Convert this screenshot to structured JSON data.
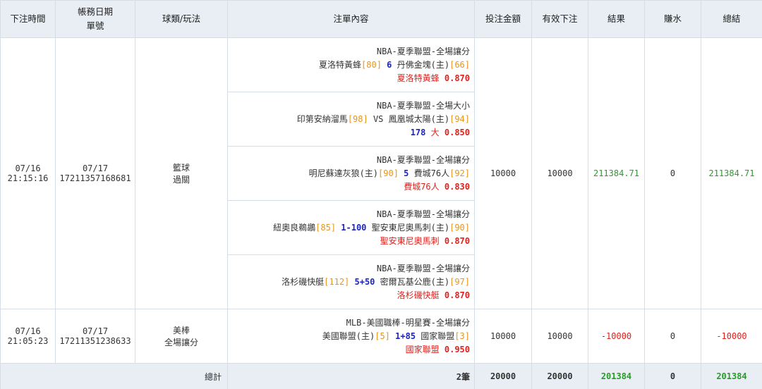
{
  "headers": {
    "time": "下注時間",
    "date_line1": "帳務日期",
    "date_line2": "單號",
    "type": "球類/玩法",
    "content": "注單內容",
    "amount": "投注金額",
    "valid": "有效下注",
    "result": "結果",
    "water": "賺水",
    "total": "總結"
  },
  "bets": [
    {
      "date": "07/16",
      "time": "21:15:16",
      "acct_date": "07/17",
      "ticket": "17211357168681",
      "sport": "籃球",
      "play": "過關",
      "amount": "10000",
      "valid": "10000",
      "result": "211384.71",
      "water": "0",
      "total": "211384.71",
      "legs": [
        {
          "league": "NBA-夏季聯盟-全場讓分",
          "team1": "夏洛特黃蜂",
          "sp1": "[80]",
          "hd": "6",
          "team2": "丹佛金塊(主)",
          "sp2": "[66]",
          "pick": "夏洛特黃蜂",
          "odds": "0.870"
        },
        {
          "league": "NBA-夏季聯盟-全場大小",
          "team1": "印第安納溜馬",
          "sp1": "[98]",
          "hd": "VS",
          "team2": "鳳凰城太陽(主)",
          "sp2": "[94]",
          "pick_hd": "178",
          "pick": "大",
          "odds": "0.850"
        },
        {
          "league": "NBA-夏季聯盟-全場讓分",
          "team1": "明尼蘇達灰狼(主)",
          "sp1": "[90]",
          "hd": "5",
          "team2": "費城76人",
          "sp2": "[92]",
          "pick": "費城76人",
          "odds": "0.830"
        },
        {
          "league": "NBA-夏季聯盟-全場讓分",
          "team1": "紐奧良鵜鶘",
          "sp1": "[85]",
          "hd": "1-100",
          "team2": "聖安東尼奧馬刺(主)",
          "sp2": "[90]",
          "pick": "聖安東尼奧馬刺",
          "odds": "0.870"
        },
        {
          "league": "NBA-夏季聯盟-全場讓分",
          "team1": "洛杉磯快艇",
          "sp1": "[112]",
          "hd": "5+50",
          "team2": "密爾瓦基公鹿(主)",
          "sp2": "[97]",
          "pick": "洛杉磯快艇",
          "odds": "0.870"
        }
      ]
    },
    {
      "date": "07/16",
      "time": "21:05:23",
      "acct_date": "07/17",
      "ticket": "17211351238633",
      "sport": "美棒",
      "play": "全場讓分",
      "amount": "10000",
      "valid": "10000",
      "result": "-10000",
      "water": "0",
      "total": "-10000",
      "legs": [
        {
          "league": "MLB-美國職棒-明星賽-全場讓分",
          "team1": "美國聯盟(主)",
          "sp1": "[5]",
          "hd": "1+85",
          "team2": "國家聯盟",
          "sp2": "[3]",
          "pick": "國家聯盟",
          "odds": "0.950"
        }
      ]
    }
  ],
  "footer": {
    "label": "總計",
    "count": "2筆",
    "amount": "20000",
    "valid": "20000",
    "result": "201384",
    "water": "0",
    "total": "201384"
  },
  "colors": {
    "header_bg": "#e8eef3",
    "spread": "#e8941a",
    "handicap": "#1a23c8",
    "pick": "#e0201c",
    "win": "#2a9a2a",
    "loss": "#e0201c"
  }
}
